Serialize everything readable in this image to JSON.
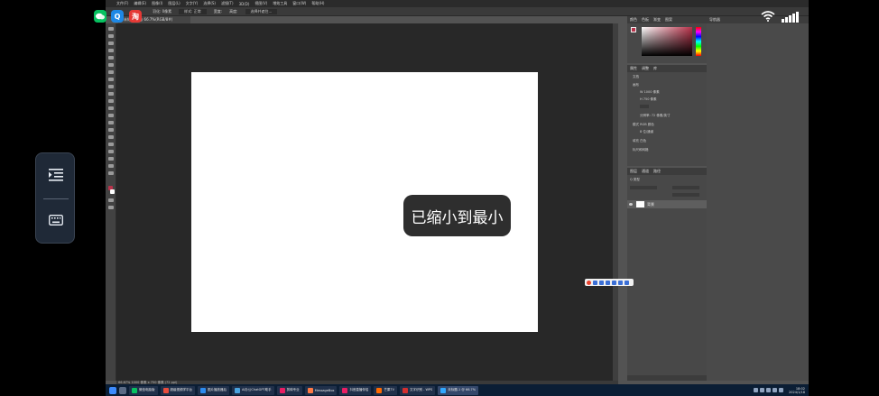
{
  "menubar": {
    "items": [
      "文件(F)",
      "编辑(E)",
      "图像(I)",
      "图层(L)",
      "文字(Y)",
      "选择(S)",
      "滤镜(T)",
      "3D(D)",
      "视图(V)",
      "增效工具",
      "窗口(W)",
      "帮助(H)"
    ]
  },
  "optbar": {
    "feather": "羽化: 0像素",
    "style": "样式: 正常",
    "width": "宽度:",
    "height": "高度:",
    "select_mask": "选择并遮住..."
  },
  "document": {
    "tab": "未标题-1 @ 66.7%(RGB/8#)",
    "status": "66.67%   1000 像素 x 750 像素 (72 ppi)"
  },
  "panels": {
    "tabs_top": [
      "颜色",
      "色板",
      "渐变",
      "图案"
    ],
    "tabs_props": [
      "属性",
      "调整",
      "库"
    ],
    "props": {
      "doc_label": "文档",
      "canvas": "画布",
      "w": "W  1000 像素",
      "h": "H  750 像素",
      "res": "分辨率: 72 像素/英寸",
      "mode": "模式  RGB 颜色",
      "depth": "8 位/通道",
      "fill": "填充  白色",
      "ruler": "标尺和网格"
    },
    "tabs_layers": [
      "图层",
      "通道",
      "路径"
    ],
    "layer_search": "Q 类型",
    "layer_name": "背景"
  },
  "right_strip": {
    "label": "导航器"
  },
  "overlay_apps": {
    "search_glyph": "Q",
    "app_glyph": "淘"
  },
  "toast": {
    "text": "已缩小到最小"
  },
  "taskbar": {
    "apps": [
      {
        "label": "微信电脑版",
        "color": "#07c160"
      },
      {
        "label": "超级视频学平台",
        "color": "#e74c3c"
      },
      {
        "label": "图片播放器后",
        "color": "#2d8cf0"
      },
      {
        "label": "AI办公ChatGPT助手",
        "color": "#4aa3df"
      },
      {
        "label": "剪映专业",
        "color": "#e91e63"
      },
      {
        "label": "MessageBox",
        "color": "#ff7a45"
      },
      {
        "label": "抖音直播伴侣",
        "color": "#e91e63"
      },
      {
        "label": "芒果TV",
        "color": "#ff6a00"
      },
      {
        "label": "文字识别 - WPS",
        "color": "#d32f2f"
      },
      {
        "label": "未标题-1 @ 66.7%",
        "color": "#31a8ff"
      }
    ],
    "time": "18:02",
    "date": "2024/1/18"
  },
  "colors": {
    "workspace": "#282828",
    "panel": "#535353",
    "toast": "#2e2e2e",
    "taskbar": "#0b1e35"
  }
}
